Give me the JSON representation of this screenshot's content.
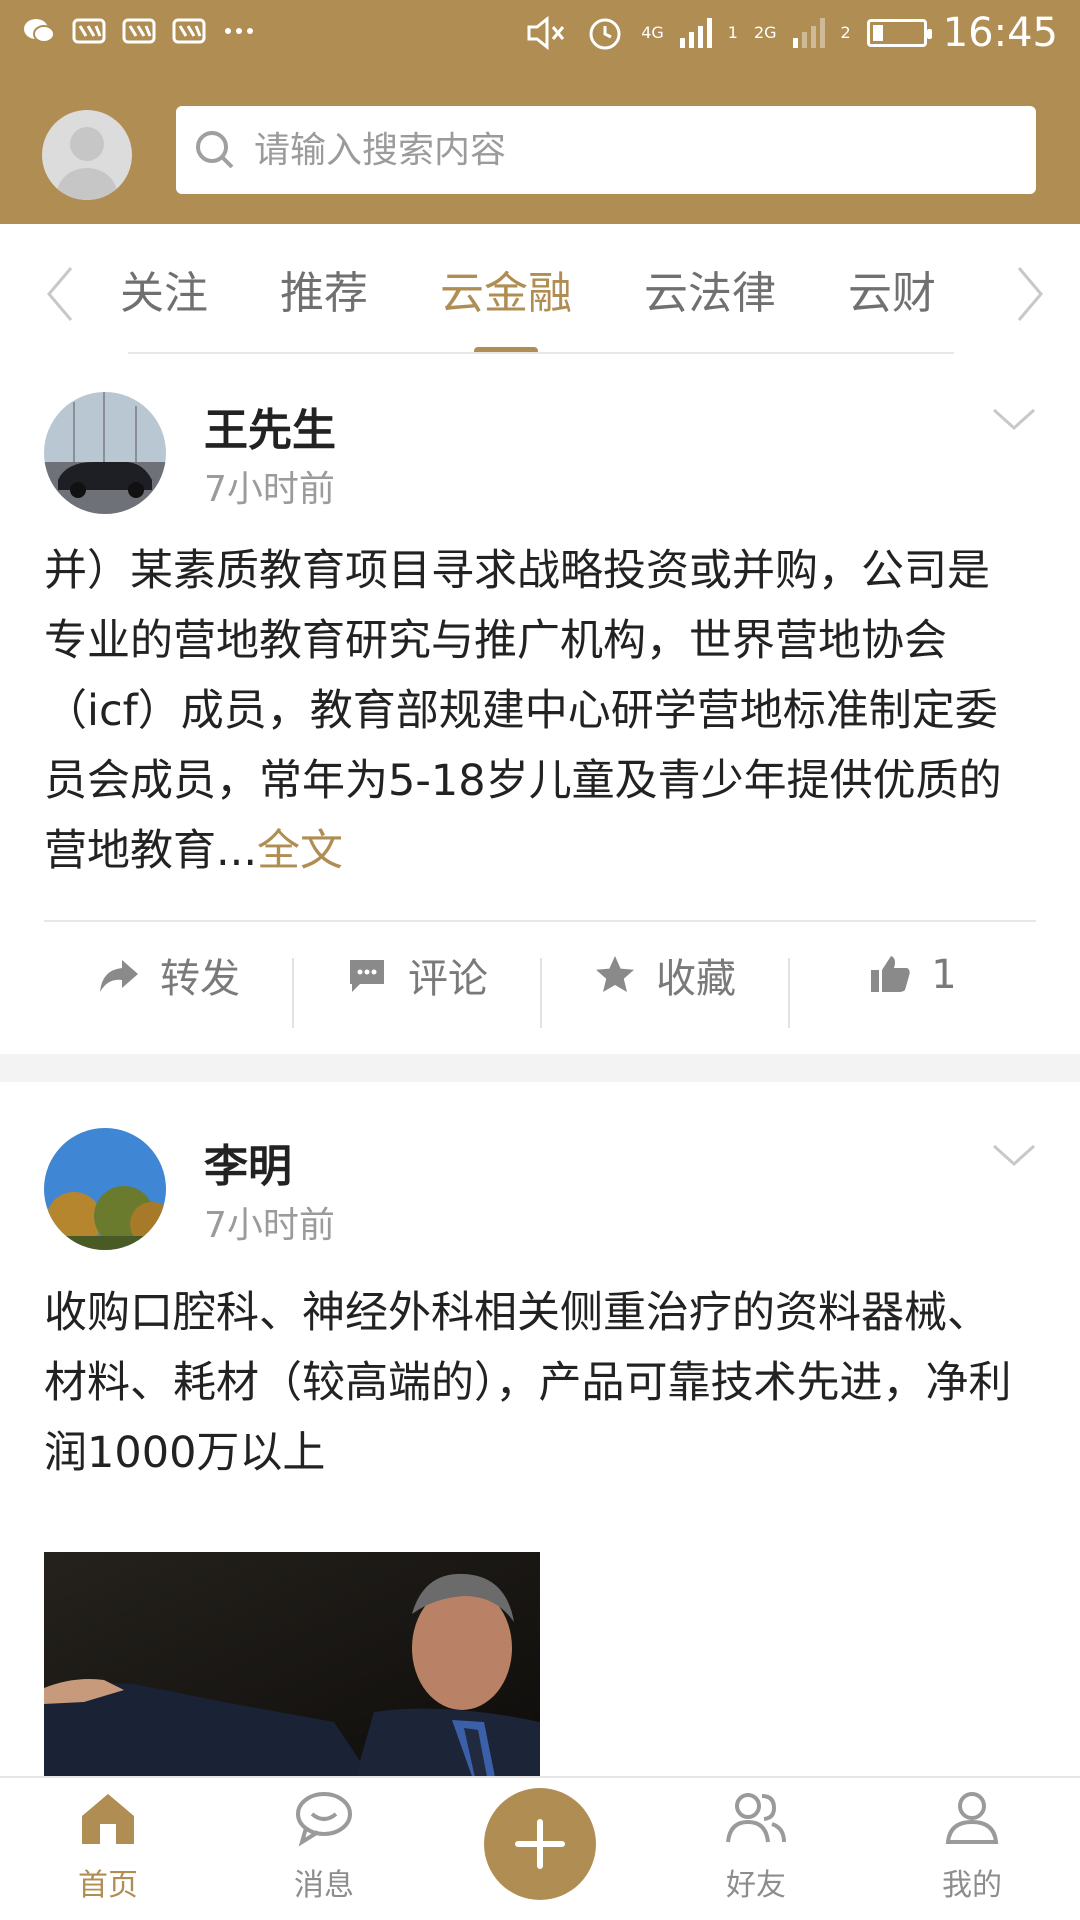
{
  "status_bar": {
    "time": "16:45",
    "network1": "4G",
    "network2": "2G",
    "sim1": "1",
    "sim2": "2",
    "icons": [
      "wechat-icon",
      "taobao-icon",
      "taobao-icon",
      "taobao-icon",
      "more-dots-icon",
      "mute-icon",
      "alarm-icon",
      "signal-icon",
      "battery-icon"
    ],
    "battery_level": 0.2
  },
  "header": {
    "search_placeholder": "请输入搜索内容"
  },
  "tabs": {
    "items": [
      {
        "label": "关注",
        "active": false
      },
      {
        "label": "推荐",
        "active": false
      },
      {
        "label": "云金融",
        "active": true
      },
      {
        "label": "云法律",
        "active": false
      },
      {
        "label": "云财",
        "active": false
      }
    ]
  },
  "posts": [
    {
      "author": "王先生",
      "time": "7小时前",
      "content": "并）某素质教育项目寻求战略投资或并购，公司是专业的营地教育研究与推广机构，世界营地协会（icf）成员，教育部规建中心研学营地标准制定委员会成员，常年为5-18岁儿童及青少年提供优质的营地教育...",
      "more_label": "全文",
      "actions": {
        "forward": "转发",
        "comment": "评论",
        "favorite": "收藏",
        "likes": "1"
      }
    },
    {
      "author": "李明",
      "time": "7小时前",
      "content": "收购口腔科、神经外科相关侧重治疗的资料器械、材料、耗材（较高端的），产品可靠技术先进，净利润1000万以上"
    }
  ],
  "bottom_nav": {
    "home": "首页",
    "messages": "消息",
    "friends": "好友",
    "mine": "我的"
  },
  "colors": {
    "brand": "#b08d53",
    "text": "#222222",
    "muted": "#9b9b9b"
  }
}
